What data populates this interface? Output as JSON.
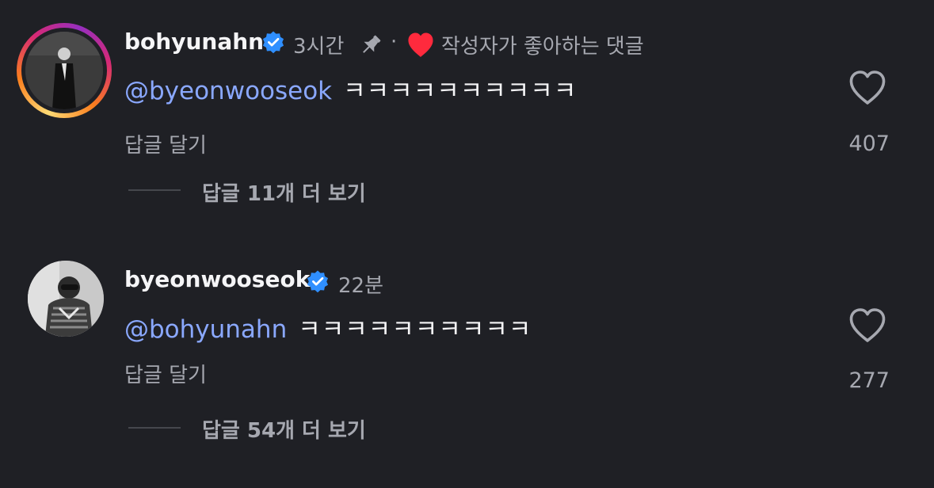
{
  "comments": [
    {
      "username": "bohyunahn",
      "verified_icon": "verified-badge-icon",
      "time": "3시간",
      "pinned_icon": "pin-icon",
      "separator": "·",
      "liked_by_author_icon": "heart-filled-icon",
      "liked_by_author_label": "작성자가 좋아하는 댓글",
      "mention": "@byeonwooseok",
      "text": "ㅋㅋㅋㅋㅋㅋㅋㅋㅋㅋ",
      "reply_label": "답글 달기",
      "like_icon": "heart-outline-icon",
      "like_count": "407",
      "view_replies_label": "답글 11개 더 보기",
      "avatar_ring": true
    },
    {
      "username": "byeonwooseok",
      "verified_icon": "verified-badge-icon",
      "time": "22분",
      "mention": "@bohyunahn",
      "text": "ㅋㅋㅋㅋㅋㅋㅋㅋㅋㅋ",
      "reply_label": "답글 달기",
      "like_icon": "heart-outline-icon",
      "like_count": "277",
      "view_replies_label": "답글 54개 더 보기",
      "avatar_ring": false
    }
  ],
  "colors": {
    "background": "#1f2025",
    "mention": "#8aa8ff",
    "muted": "#a6a8b0",
    "verified": "#2f8fff",
    "heart_red": "#ff2a3d"
  }
}
